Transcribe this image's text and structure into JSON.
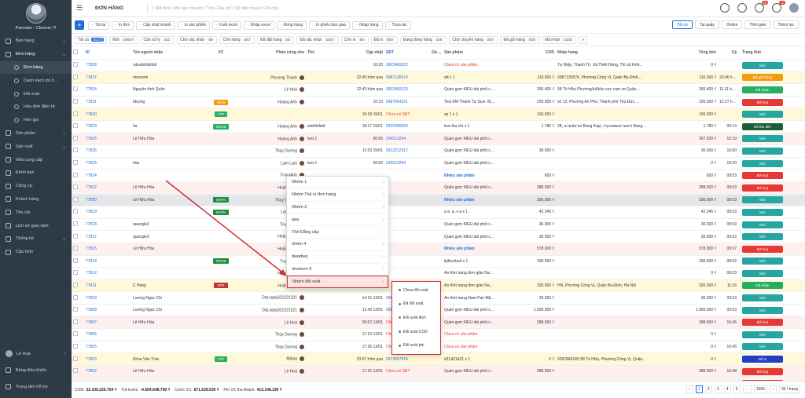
{
  "sidebar": {
    "brand_name": "Pancake - Clonner !!!",
    "items": [
      {
        "label": "Bán hàng",
        "icon": "cart-icon"
      },
      {
        "label": "Đơn hàng",
        "icon": "receipt-icon"
      },
      {
        "label": "Đơn hàng",
        "icon": "dot-icon"
      },
      {
        "label": "Danh sách trả h...",
        "icon": "dot-icon"
      },
      {
        "label": "Đối soát",
        "icon": "dot-icon"
      },
      {
        "label": "Hóa đơn điện tử",
        "icon": "dot-icon"
      },
      {
        "label": "Hẹn gọi",
        "icon": "dot-icon"
      },
      {
        "label": "Sản phẩm",
        "icon": "box-icon"
      },
      {
        "label": "Sản xuất",
        "icon": "factory-icon"
      },
      {
        "label": "Nhà cung cấp",
        "icon": "truck-icon"
      },
      {
        "label": "Kênh bán",
        "icon": "store-icon"
      },
      {
        "label": "Công nợ",
        "icon": "debt-icon"
      },
      {
        "label": "Khách hàng",
        "icon": "users-icon"
      },
      {
        "label": "Thu chi",
        "icon": "wallet-icon"
      },
      {
        "label": "Lịch sử giao dịch",
        "icon": "history-icon"
      },
      {
        "label": "Thống kê",
        "icon": "chart-icon"
      },
      {
        "label": "Cấu hình",
        "icon": "gear-icon"
      }
    ],
    "user_name": "Lê Hoà",
    "dashboard": "Bảng điều khiển",
    "support": "Trung tâm hỗ trợ"
  },
  "topbar": {
    "title": "ĐƠN HÀNG",
    "search_placeholder": "Mã đơn / Mã vận chuyển / Tên / Địa chỉ / Số điện thoại / Ghi chú",
    "bell_count": "56",
    "headset_count": "10"
  },
  "toolbar": {
    "buttons": [
      "Tải lại",
      "In đơn",
      "Cập nhật nhanh",
      "In sản phẩm",
      "Xuất excel",
      "Nhập excel",
      "Đóng hàng",
      "In phiếu bàn giao",
      "Nhập hàng",
      "Thao tác"
    ],
    "views": [
      "Tất cả",
      "Tại quầy",
      "Online",
      "Thời gian",
      "Thêm lọc"
    ]
  },
  "filters": [
    {
      "label": "Tất cả",
      "count": "45170"
    },
    {
      "label": "Mới",
      "count": "29647"
    },
    {
      "label": "Cần xử lý",
      "count": "411"
    },
    {
      "label": "Chờ xác nhận",
      "count": "69"
    },
    {
      "label": "Chờ hàng",
      "count": "457"
    },
    {
      "label": "Đã đặt hàng",
      "count": "35"
    },
    {
      "label": "Đã xác nhận",
      "count": "2357"
    },
    {
      "label": "Chờ in",
      "count": "88"
    },
    {
      "label": "Đã in",
      "count": "850"
    },
    {
      "label": "Đang đóng hàng",
      "count": "146"
    },
    {
      "label": "Chờ chuyển hàng",
      "count": "257"
    },
    {
      "label": "Đã gửi hàng",
      "count": "630"
    },
    {
      "label": "Đã nhận",
      "count": "1230"
    }
  ],
  "table": {
    "headers": [
      "ID",
      "Tên người nhận",
      "VC",
      "Phân công cho",
      "Thẻ",
      "Cập nhật",
      "SĐT",
      "Ghi chú",
      "Sản phẩm",
      "COD",
      "Nhận hàng",
      "Tổng tiền",
      "Cậ",
      "Trạng thái"
    ],
    "rows": [
      {
        "id": "77838",
        "name": "vdsvdsfdsfdsf",
        "vc": "",
        "vc_color": "",
        "assign": "",
        "tag": "",
        "time": "10:20",
        "phone": "0923460022",
        "product": "Chưa có sản phẩm",
        "cod": "",
        "addr": "Tự Hiệp, Thanh Trì, Xã Thiết Hùng, Thị xã Kinh...",
        "total": "0 ₫",
        "ca": "",
        "status": "Mới",
        "status_color": "#26a6a0",
        "bg": "",
        "pred": true
      },
      {
        "id": "77837",
        "name": "nnnnnnn",
        "vc": "",
        "vc_color": "",
        "assign": "Phương Thanh",
        "tag": "",
        "time": "22:45 hôm qua",
        "phone": "0987130574",
        "product": "dd x 1",
        "cod": "110.000 ₫",
        "addr": "0987130576, Phường Cống Vị, Quận Ba Đình,...",
        "total": "110.000 ₫",
        "ca": "20:46 hôm",
        "status": "Đã gửi hàng",
        "status_color": "#f39c12",
        "bg": "yellow",
        "pred": false
      },
      {
        "id": "77834",
        "name": "Nguyễn Anh Quân",
        "vc": "",
        "vc_color": "",
        "assign": "Lê Hoà",
        "tag": "",
        "time": "12:43 hôm qua",
        "phone": "0923460123",
        "product": "Quần gym KIỂU dài phối c...",
        "cod": "260.400 ₫",
        "addr": "58 Tố Hữu Phường/xã/khu vực cầm xe Quận...",
        "total": "260.400 ₫",
        "ca": "11:11 hôm",
        "status": "Đã nhận",
        "status_color": "#27ae60",
        "bg": "",
        "pred": false
      },
      {
        "id": "77831",
        "name": "tduong",
        "vc": "GHN",
        "vc_color": "#f39c12",
        "assign": "Hoàng Anh",
        "tag": "",
        "time": "10:13",
        "phone": "0987654321",
        "product": "Test KM Thanh Tự Size: M,...",
        "cod": "220.000 ₫",
        "addr": "số 12, Phường An Phú, Thành phố Thủ Đức,...",
        "total": "220.000 ₫",
        "ca": "12:27 hôm",
        "status": "Đã huỷ",
        "status_color": "#e53935",
        "bg": "",
        "pred": false
      },
      {
        "id": "77830",
        "name": "",
        "vc": "VTP",
        "vc_color": "#27ae60",
        "assign": "",
        "tag": "",
        "time": "19:18 15/01",
        "phone": "Chưa có SĐT",
        "product": "sp 1 x 1",
        "cod": "100.000 ₫",
        "addr": "",
        "total": "100.000 ₫",
        "ca": "",
        "status": "Mới",
        "status_color": "#26a6a0",
        "bg": "yellow",
        "pred": false
      },
      {
        "id": "77829",
        "name": "ha",
        "vc": "GRAB",
        "vc_color": "#27ae60",
        "assign": "Hoàng Anh",
        "tag": "sdsfdsfdsf",
        "time": "18:17 15/01",
        "phone": "0329399659",
        "product": "test thu chi x 1",
        "cod": "1.780 ₫",
        "addr": "28, ฉายฟลาย/ Bang Kapi, กรุงเทพมหานคร/ Bang...",
        "total": "1.780 ₫",
        "ca": "06:14",
        "status": "Đã thu tiền",
        "status_color": "#1b5e3a",
        "bg": "",
        "pred": false
      },
      {
        "id": "77826",
        "name": "Lê Hữu Hòa",
        "vc": "",
        "vc_color": "",
        "assign": "Hoàng Anh",
        "tag": "test 1",
        "time": "00:00",
        "phone": "234513254",
        "product": "Quần gym KIỂU dài phối c...",
        "cod": "",
        "addr": "",
        "total": "307.200 ₫",
        "ca": "10:19",
        "status": "Mới",
        "status_color": "#26a6a0",
        "bg": "pink",
        "pred": false
      },
      {
        "id": "77826",
        "name": "",
        "vc": "",
        "vc_color": "",
        "assign": "Thùy Dương",
        "tag": "",
        "time": "11:53 15/01",
        "phone": "0912312312",
        "product": "Quần gym KIỂU dài phối c...",
        "cod": "30.000 ₫",
        "addr": "",
        "total": "30.000 ₫",
        "ca": "10:00",
        "status": "Mới",
        "status_color": "#26a6a0",
        "bg": "",
        "pred": false
      },
      {
        "id": "77825",
        "name": "hòa",
        "vc": "",
        "vc_color": "",
        "assign": "Lam Lam",
        "tag": "test 1",
        "time": "00:00",
        "phone": "234513254",
        "product": "Quần gym KIỂU dài phối c...",
        "cod": "",
        "addr": "",
        "total": "0 ₫",
        "ca": "10:20",
        "status": "Mới",
        "status_color": "#26a6a0",
        "bg": "",
        "pred": false
      },
      {
        "id": "77824",
        "name": "",
        "vc": "",
        "vc_color": "",
        "assign": "TrungAnh",
        "tag": "",
        "time": "",
        "phone": "",
        "product": "Nhiều sản phẩm",
        "cod": "600 ₫",
        "addr": "",
        "total": "600 ₫",
        "ca": "09:53",
        "status": "Đã huỷ",
        "status_color": "#e53935",
        "bg": "",
        "pred": false
      },
      {
        "id": "77822",
        "name": "Lê Hữu Hòa",
        "vc": "",
        "vc_color": "",
        "assign": "Hoàng Anh",
        "tag": "",
        "time": "",
        "phone": "",
        "product": "Quần gym KIỂU dài phối c...",
        "cod": "288.000 ₫",
        "addr": "",
        "total": "288.000 ₫",
        "ca": "09:53",
        "status": "Đã huỷ",
        "status_color": "#e53935",
        "bg": "pink",
        "pred": false
      },
      {
        "id": "77820",
        "name": "Lê Hữu Hòa",
        "vc": "GHTK",
        "vc_color": "#1e8e3e",
        "assign": "Thùy Dương",
        "tag": "",
        "time": "",
        "phone": "",
        "product": "Nhiều sản phẩm",
        "cod": "330.000 ₫",
        "addr": "",
        "total": "330.000 ₫",
        "ca": "09:53",
        "status": "Mới",
        "status_color": "#26a6a0",
        "bg": "gray",
        "pred": false
      },
      {
        "id": "77819",
        "name": "",
        "vc": "GHTK",
        "vc_color": "#1e8e3e",
        "assign": "Lam Lam",
        "tag": "",
        "time": "",
        "phone": "",
        "product": "a a. a, x a x 1",
        "cod": "42.345 ₫",
        "addr": "",
        "total": "42.345 ₫",
        "ca": "09:53",
        "status": "Mới",
        "status_color": "#26a6a0",
        "bg": "",
        "pred": false
      },
      {
        "id": "77818",
        "name": "quangle3",
        "vc": "",
        "vc_color": "",
        "assign": "TrungAnh",
        "tag": "",
        "time": "",
        "phone": "",
        "product": "Quần gym KIỂU dài phối c...",
        "cod": "30.000 ₫",
        "addr": "",
        "total": "30.000 ₫",
        "ca": "09:53",
        "status": "Mới",
        "status_color": "#26a6a0",
        "bg": "",
        "pred": false
      },
      {
        "id": "77817",
        "name": "quangle3",
        "vc": "",
        "vc_color": "",
        "assign": "Hoàng Anh",
        "tag": "",
        "time": "",
        "phone": "",
        "product": "Quần gym KIỂU dài phối c...",
        "cod": "30.000 ₫",
        "addr": "",
        "total": "30.000 ₫",
        "ca": "09:53",
        "status": "Mới",
        "status_color": "#26a6a0",
        "bg": "",
        "pred": false
      },
      {
        "id": "77815",
        "name": "Lê Hữu Hòa",
        "vc": "",
        "vc_color": "",
        "assign": "Hoàng Anh",
        "tag": "",
        "time": "",
        "phone": "",
        "product": "Nhiều sản phẩm",
        "cod": "578.000 ₫",
        "addr": "",
        "total": "578.000 ₫",
        "ca": "09:07",
        "status": "Đã huỷ",
        "status_color": "#e53935",
        "bg": "pink",
        "pred": false
      },
      {
        "id": "77814",
        "name": "",
        "vc": "GRAB",
        "vc_color": "#1e8e3e",
        "assign": "TrungAnh",
        "tag": "",
        "time": "",
        "phone": "",
        "product": "kjdbvcbsd x 1",
        "cod": "330.000 ₫",
        "addr": "",
        "total": "330.000 ₫",
        "ca": "08:02",
        "status": "Mới",
        "status_color": "#26a6a0",
        "bg": "",
        "pred": false
      },
      {
        "id": "77812",
        "name": "",
        "vc": "",
        "vc_color": "",
        "assign": "Hoàng Anh",
        "tag": "",
        "time": "",
        "phone": "",
        "product": "Áo thời trang đơn giản Na...",
        "cod": "",
        "addr": "",
        "total": "0 ₫",
        "ca": "09:53",
        "status": "Mới",
        "status_color": "#26a6a0",
        "bg": "",
        "pred": false
      },
      {
        "id": "77811",
        "name": "C Hang",
        "vc": "SPS",
        "vc_color": "#c0392b",
        "assign": "Hoàng Anh",
        "tag": "",
        "time": "",
        "phone": "",
        "product": "Áo thời trang đơn giản Na...",
        "cod": "320.000 ₫",
        "addr": "HN, Phường Cống Vị, Quận Ba Đình, Hà Nội",
        "total": "320.000 ₫",
        "ca": "11:16",
        "status": "Đã nhận",
        "status_color": "#27ae60",
        "bg": "yellow",
        "pred": false
      },
      {
        "id": "77809",
        "name": "Lương Ngọc Chi",
        "vc": "",
        "vc_color": "",
        "assign": "Dat.sqsq321321321",
        "tag": "",
        "time": "14:15 13/01",
        "phone": "0986",
        "product": "Áo thời trang Nam Pari Mặ...",
        "cod": "30.000 ₫",
        "addr": "",
        "total": "30.000 ₫",
        "ca": "09:53",
        "status": "Mới",
        "status_color": "#26a6a0",
        "bg": "",
        "pred": false
      },
      {
        "id": "77808",
        "name": "Lương Ngọc Chi",
        "vc": "",
        "vc_color": "",
        "assign": "Dat.sqsq321321321",
        "tag": "",
        "time": "11:43 13/01",
        "phone": "0986",
        "product": "Quần gym KIỂU dài phối c...",
        "cod": "1.500.000 ₫",
        "addr": "",
        "total": "1.500.000 ₫",
        "ca": "09:53",
        "status": "Mới",
        "status_color": "#26a6a0",
        "bg": "",
        "pred": false
      },
      {
        "id": "77807",
        "name": "Lê Hữu Hòa",
        "vc": "",
        "vc_color": "",
        "assign": "Lê Hoà",
        "tag": "",
        "time": "09:52 13/01",
        "phone": "Chưa có",
        "product": "Quần gym KIỂU dài phối c...",
        "cod": "288.000 ₫",
        "addr": "",
        "total": "288.000 ₫",
        "ca": "16:45",
        "status": "Đã huỷ",
        "status_color": "#e53935",
        "bg": "pink",
        "pred": false
      },
      {
        "id": "77806",
        "name": "",
        "vc": "",
        "vc_color": "",
        "assign": "Thùy Dương",
        "tag": "",
        "time": "17:13 12/01",
        "phone": "Chưa có",
        "product": "Chưa có sản phẩm",
        "cod": "",
        "addr": "",
        "total": "0 ₫",
        "ca": "",
        "status": "Mới",
        "status_color": "#26a6a0",
        "bg": "",
        "pred": true
      },
      {
        "id": "77805",
        "name": "",
        "vc": "",
        "vc_color": "",
        "assign": "Thùy Dương",
        "tag": "",
        "time": "17:26 12/01",
        "phone": "Chưa có",
        "product": "Chưa có sản phẩm",
        "cod": "",
        "addr": "",
        "total": "0 ₫",
        "ca": "16:45",
        "status": "Mới",
        "status_color": "#26a6a0",
        "bg": "",
        "pred": true
      },
      {
        "id": "77803",
        "name": "Khoa Văn Trần",
        "vc": "VTP",
        "vc_color": "#27ae60",
        "assign": "Mihaa",
        "tag": "",
        "time": "23:07 hôm qua",
        "phone": "0973667874",
        "product": "d21d21d21 x 1",
        "cod": "0 ₫",
        "addr": "0397849165 58 Tố Hữu, Phường Cống Vị, Quận...",
        "total": "0 ₫",
        "ca": "",
        "status": "Đã in",
        "status_color": "#1e40c8",
        "bg": "yellow",
        "pred": false
      },
      {
        "id": "77802",
        "name": "Lê Hữu Hòa",
        "vc": "",
        "vc_color": "",
        "assign": "Lê Hoà",
        "tag": "",
        "time": "17:26 12/01",
        "phone": "Chưa có SĐT",
        "product": "Quần gym KIỂU dài phối c...",
        "cod": "288.000 ₫",
        "addr": "",
        "total": "288.000 ₫",
        "ca": "16:48",
        "status": "Đã huỷ",
        "status_color": "#e53935",
        "bg": "pink",
        "pred": false
      },
      {
        "id": "77801",
        "name": "Lê Hữu Hòa",
        "vc": "",
        "vc_color": "",
        "assign": "Lê Hoà",
        "tag": "",
        "time": "14:32 12/01",
        "phone": "Chưa có SĐT",
        "product": "Quần gym KIỂU dài phối c...",
        "cod": "288.000 ₫",
        "addr": "",
        "total": "288.000 ₫",
        "ca": "",
        "status": "Đã huỷ",
        "status_color": "#e53935",
        "bg": "pink",
        "pred": false
      }
    ]
  },
  "context_menu": {
    "items": [
      "Nhóm 1",
      "Nhóm Thẻ in đơn hàng",
      "Nhóm 2",
      "aaa",
      "Thẻ Đẳng cấp",
      "nhóm 4",
      "dwqdwq",
      "nhowum 5",
      "Nhóm đối soát"
    ],
    "submenu": [
      "Chưa đối soát",
      "Đã đối soát",
      "Đối soát lệch",
      "Đối soát COD",
      "Đối soát phí"
    ]
  },
  "footer": {
    "cod_label": "COD:",
    "cod": "32.105.225.754 ₫",
    "paid_label": "Trả trước:",
    "paid": "-4.564.648.790 ₫",
    "ship_label": "Cước VC:",
    "ship": "871.628.530 ₫",
    "fee_label": "Phí VC thu khách:",
    "fee": "413.148.195 ₫",
    "pages": [
      "1",
      "2",
      "3",
      "4",
      "5"
    ],
    "last_page": "1506",
    "per_page": "30 / trang"
  },
  "colors": {
    "sidebar_bg": "#2e3a46",
    "accent": "#1f6fd6",
    "highlight": "#d32f2f"
  }
}
